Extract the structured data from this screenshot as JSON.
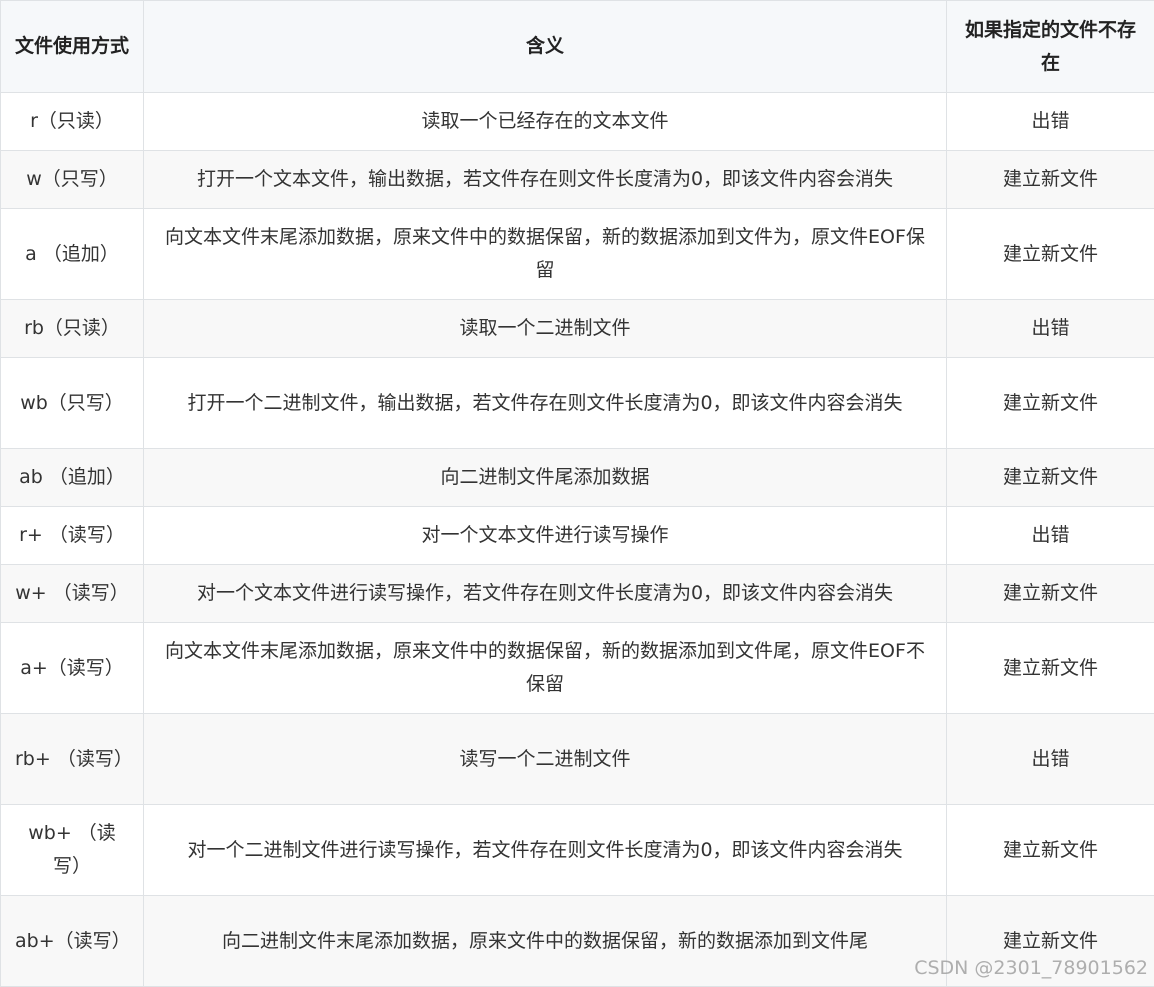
{
  "table": {
    "headers": [
      "文件使用方式",
      "含义",
      "如果指定的文件不存在"
    ],
    "rows": [
      {
        "mode": "r（只读）",
        "meaning": "读取一个已经存在的文本文件",
        "if_missing": "出错"
      },
      {
        "mode": "w（只写）",
        "meaning": "打开一个文本文件，输出数据，若文件存在则文件长度清为0，即该文件内容会消失",
        "if_missing": "建立新文件"
      },
      {
        "mode": "a （追加）",
        "meaning": "向文本文件末尾添加数据，原来文件中的数据保留，新的数据添加到文件为，原文件EOF保留",
        "if_missing": "建立新文件"
      },
      {
        "mode": "rb（只读）",
        "meaning": "读取一个二进制文件",
        "if_missing": "出错"
      },
      {
        "mode": "wb（只写）",
        "meaning": "打开一个二进制文件，输出数据，若文件存在则文件长度清为0，即该文件内容会消失",
        "if_missing": "建立新文件"
      },
      {
        "mode": "ab （追加）",
        "meaning": "向二进制文件尾添加数据",
        "if_missing": "建立新文件"
      },
      {
        "mode": "r+ （读写）",
        "meaning": "对一个文本文件进行读写操作",
        "if_missing": "出错"
      },
      {
        "mode": "w+ （读写）",
        "meaning": "对一个文本文件进行读写操作，若文件存在则文件长度清为0，即该文件内容会消失",
        "if_missing": "建立新文件"
      },
      {
        "mode": "a+（读写）",
        "meaning": "向文本文件末尾添加数据，原来文件中的数据保留，新的数据添加到文件尾，原文件EOF不保留",
        "if_missing": "建立新文件"
      },
      {
        "mode": "rb+ （读写）",
        "meaning": "读写一个二进制文件",
        "if_missing": "出错"
      },
      {
        "mode": "wb+ （读写）",
        "meaning": "对一个二进制文件进行读写操作，若文件存在则文件长度清为0，即该文件内容会消失",
        "if_missing": "建立新文件"
      },
      {
        "mode": "ab+（读写）",
        "meaning": "向二进制文件末尾添加数据，原来文件中的数据保留，新的数据添加到文件尾",
        "if_missing": "建立新文件"
      }
    ]
  },
  "watermark": "CSDN @2301_78901562"
}
